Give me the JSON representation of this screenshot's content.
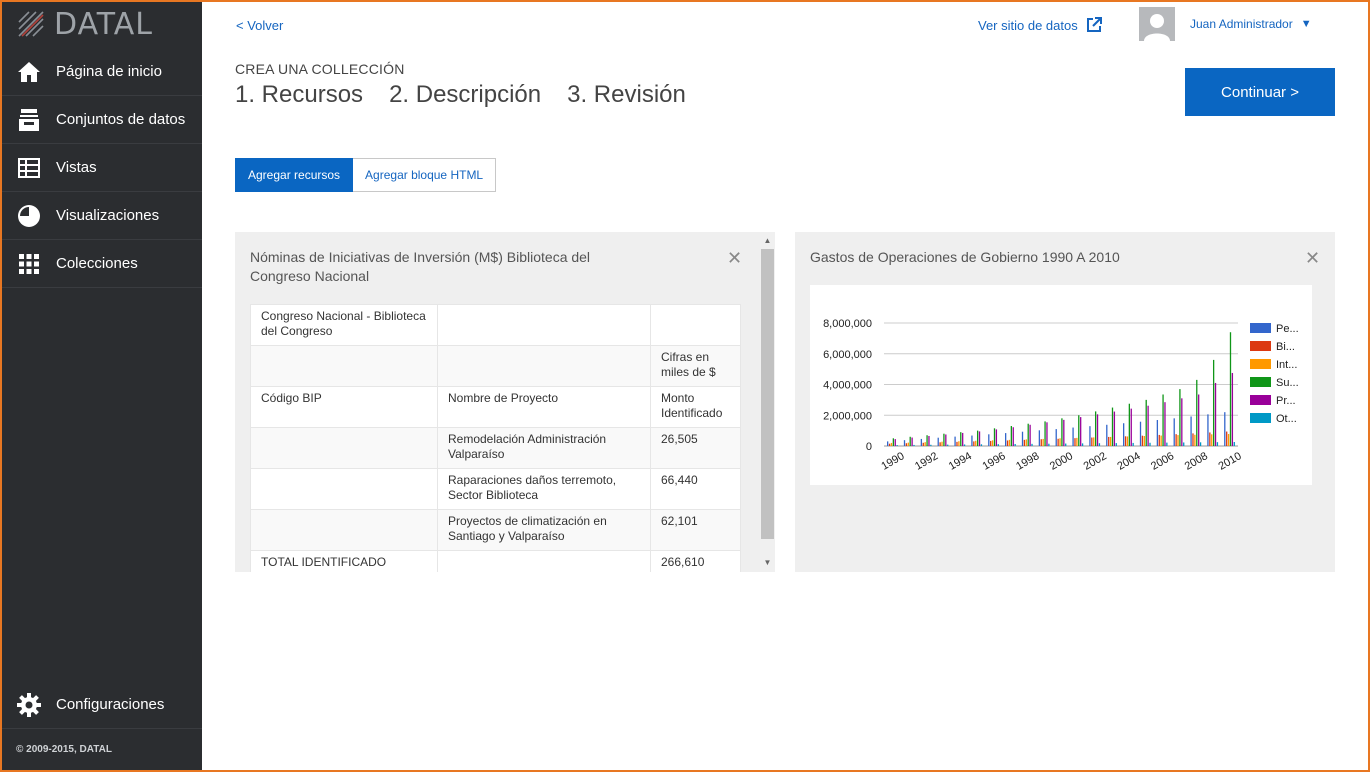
{
  "app": {
    "logo_text": "DATAL"
  },
  "sidebar": {
    "items": [
      {
        "label": "Página de inicio",
        "icon": "home-icon"
      },
      {
        "label": "Conjuntos de datos",
        "icon": "inbox-icon"
      },
      {
        "label": "Vistas",
        "icon": "table-icon"
      },
      {
        "label": "Visualizaciones",
        "icon": "pie-chart-icon"
      },
      {
        "label": "Colecciones",
        "icon": "grid-icon"
      }
    ],
    "config_label": "Configuraciones",
    "copyright": "© 2009-2015, DATAL"
  },
  "header": {
    "back": "< Volver",
    "site_link": "Ver sitio de datos",
    "user_name": "Juan Administrador",
    "user_caret": "▼"
  },
  "wizard": {
    "collection_label": "CREA UNA COLLECCIÓN",
    "steps": [
      "1. Recursos",
      "2. Descripción",
      "3. Revisión"
    ],
    "continue": "Continuar >"
  },
  "tabs": {
    "add_resources": "Agregar recursos",
    "add_html": "Agregar bloque HTML"
  },
  "left_panel": {
    "title": "Nóminas de Iniciativas de Inversión (M$) Biblioteca del Congreso Nacional",
    "close": "✕",
    "rows": [
      [
        "Congreso Nacional - Biblioteca del Congreso",
        "",
        ""
      ],
      [
        "",
        "",
        "Cifras en miles de $"
      ],
      [
        "Código BIP",
        "Nombre de Proyecto",
        "Monto Identificado"
      ],
      [
        "",
        "Remodelación Administración Valparaíso",
        "26,505"
      ],
      [
        "",
        "Raparaciones daños terremoto, Sector Biblioteca",
        "66,440"
      ],
      [
        "",
        "Proyectos de climatización en Santiago y Valparaíso",
        "62,101"
      ],
      [
        "TOTAL IDENTIFICADO",
        "",
        "266,610"
      ]
    ]
  },
  "right_panel": {
    "title": "Gastos de Operaciones de Gobierno 1990 A 2010",
    "close": "✕"
  },
  "chart_data": {
    "type": "bar",
    "title": "",
    "x": [
      1990,
      1991,
      1992,
      1993,
      1994,
      1995,
      1996,
      1997,
      1998,
      1999,
      2000,
      2001,
      2002,
      2003,
      2004,
      2005,
      2006,
      2007,
      2008,
      2009,
      2010
    ],
    "x_tick_labels": [
      "1990",
      "1992",
      "1994",
      "1996",
      "1998",
      "2000",
      "2002",
      "2004",
      "2006",
      "2008",
      "2010"
    ],
    "y_tick_labels": [
      "0",
      "2,000,000",
      "4,000,000",
      "6,000,000",
      "8,000,000"
    ],
    "ylim": [
      0,
      8000000
    ],
    "grid": true,
    "legend_position": "right",
    "series": [
      {
        "name": "Pe...",
        "color": "#3366cc",
        "values": [
          300000,
          380000,
          460000,
          540000,
          610000,
          680000,
          760000,
          840000,
          930000,
          1020000,
          1100000,
          1200000,
          1290000,
          1380000,
          1480000,
          1580000,
          1690000,
          1800000,
          1920000,
          2060000,
          2200000
        ]
      },
      {
        "name": "Bi...",
        "color": "#dc3912",
        "values": [
          150000,
          180000,
          210000,
          240000,
          270000,
          300000,
          330000,
          360000,
          400000,
          440000,
          470000,
          510000,
          550000,
          590000,
          630000,
          670000,
          720000,
          770000,
          820000,
          880000,
          940000
        ]
      },
      {
        "name": "Int...",
        "color": "#ff9900",
        "values": [
          200000,
          220000,
          250000,
          280000,
          310000,
          340000,
          370000,
          400000,
          430000,
          460000,
          500000,
          530000,
          560000,
          590000,
          620000,
          650000,
          680000,
          710000,
          730000,
          760000,
          780000
        ]
      },
      {
        "name": "Su...",
        "color": "#109618",
        "values": [
          500000,
          600000,
          700000,
          800000,
          900000,
          1000000,
          1150000,
          1300000,
          1450000,
          1600000,
          1800000,
          2000000,
          2250000,
          2500000,
          2750000,
          3000000,
          3350000,
          3700000,
          4300000,
          5600000,
          7400000
        ]
      },
      {
        "name": "Pr...",
        "color": "#990099",
        "values": [
          450000,
          550000,
          650000,
          750000,
          850000,
          950000,
          1080000,
          1220000,
          1380000,
          1540000,
          1700000,
          1880000,
          2060000,
          2240000,
          2430000,
          2620000,
          2850000,
          3100000,
          3350000,
          4100000,
          4750000
        ]
      },
      {
        "name": "Ot...",
        "color": "#0099c6",
        "values": [
          60000,
          70000,
          80000,
          90000,
          100000,
          110000,
          120000,
          130000,
          140000,
          150000,
          160000,
          170000,
          180000,
          190000,
          200000,
          210000,
          220000,
          230000,
          240000,
          250000,
          260000
        ]
      }
    ]
  }
}
